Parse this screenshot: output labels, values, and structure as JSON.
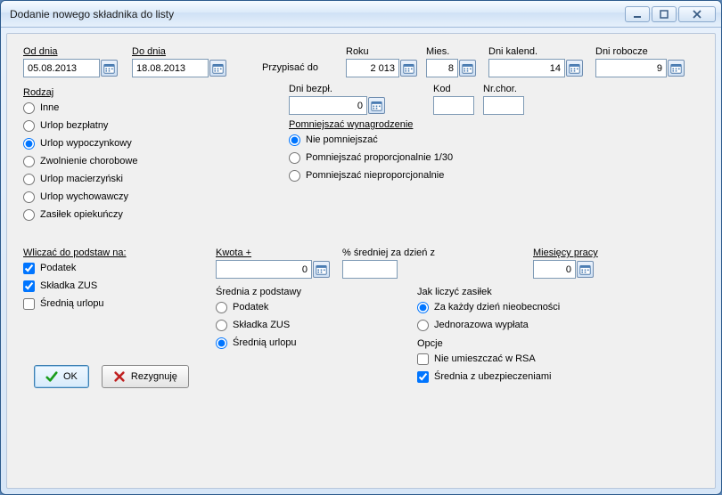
{
  "window": {
    "title": "Dodanie nowego składnika do listy"
  },
  "dates": {
    "from_label": "Od dnia",
    "to_label": "Do dnia",
    "from_value": "05.08.2013",
    "to_value": "18.08.2013"
  },
  "assign": {
    "label": "Przypisać do",
    "year_label": "Roku",
    "year_value": "2 013",
    "month_label": "Mies.",
    "month_value": "8",
    "caldays_label": "Dni kalend.",
    "caldays_value": "14",
    "workdays_label": "Dni robocze",
    "workdays_value": "9",
    "unpaid_label": "Dni bezpł.",
    "unpaid_value": "0",
    "code_label": "Kod",
    "code_value": "",
    "sick_label": "Nr.chor.",
    "sick_value": ""
  },
  "type": {
    "label": "Rodzaj",
    "options": [
      "Inne",
      "Urlop bezpłatny",
      "Urlop wypoczynkowy",
      "Zwolnienie chorobowe",
      "Urlop macierzyński",
      "Urlop wychowawczy",
      "Zasiłek opiekuńczy"
    ],
    "selected_index": 2
  },
  "reduce": {
    "label": "Pomniejszać wynagrodzenie",
    "options": [
      "Nie pomniejszać",
      "Pomniejszać proporcjonalnie 1/30",
      "Pomniejszać nieproporcjonalnie"
    ],
    "selected_index": 0
  },
  "include_base": {
    "label": "Wliczać do podstaw na:",
    "items": [
      {
        "label": "Podatek",
        "checked": true
      },
      {
        "label": "Składka ZUS",
        "checked": true
      },
      {
        "label": "Średnią urlopu",
        "checked": false
      }
    ]
  },
  "amount": {
    "label": "Kwota +",
    "value": "0"
  },
  "percent_daily": {
    "label": "% średniej za dzień z",
    "value": ""
  },
  "months_work": {
    "label": "Miesięcy pracy",
    "value": "0"
  },
  "avg_base": {
    "label": "Średnia z podstawy",
    "options": [
      "Podatek",
      "Składka ZUS",
      "Średnią urlopu"
    ],
    "selected_index": 2
  },
  "benefit_calc": {
    "label": "Jak liczyć zasiłek",
    "options": [
      "Za każdy dzień nieobecności",
      "Jednorazowa wypłata"
    ],
    "selected_index": 0
  },
  "options": {
    "label": "Opcje",
    "items": [
      {
        "label": "Nie umieszczać w RSA",
        "checked": false
      },
      {
        "label": "Średnia z ubezpieczeniami",
        "checked": true
      }
    ]
  },
  "buttons": {
    "ok": "OK",
    "cancel": "Rezygnuję"
  }
}
